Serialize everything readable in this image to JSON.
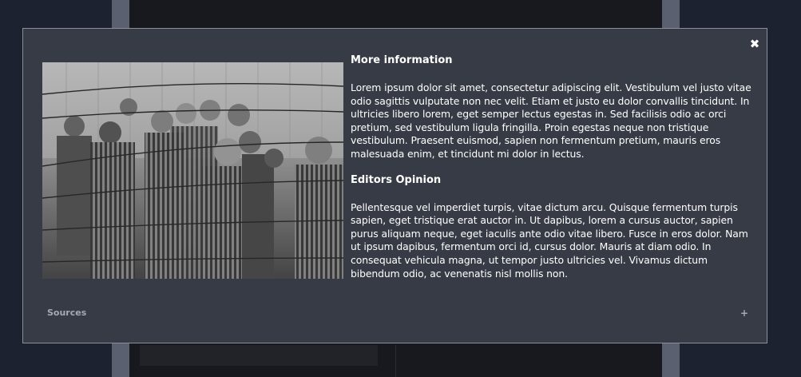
{
  "modal": {
    "close_icon": "close-icon",
    "photo_icon": "image",
    "sections": [
      {
        "heading": "More information",
        "body": "Lorem ipsum dolor sit amet, consectetur adipiscing elit. Vestibulum vel justo vitae odio sagittis vulputate non nec velit. Etiam et justo eu dolor convallis tincidunt. In ultricies libero lorem, eget semper lectus egestas in. Sed facilisis odio ac orci pretium, sed vestibulum ligula fringilla. Proin egestas neque non tristique vestibulum. Praesent euismod, sapien non fermentum pretium, mauris eros malesuada enim, et tincidunt mi dolor in lectus."
      },
      {
        "heading": "Editors Opinion",
        "body": "Pellentesque vel imperdiet turpis, vitae dictum arcu. Quisque fermentum turpis sapien, eget tristique erat auctor in. Ut dapibus, lorem a cursus auctor, sapien purus aliquam neque, eget iaculis ante odio vitae libero. Fusce in eros dolor. Nam ut ipsum dapibus, fermentum orci id, cursus dolor. Mauris at diam odio. In consequat vehicula magna, ut tempor justo ultricies vel. Vivamus dictum bibendum odio, ac venenatis nisl mollis non."
      }
    ],
    "sources": {
      "label": "Sources",
      "toggle": "+"
    }
  },
  "colors": {
    "modal_bg": "#363b45",
    "modal_border": "#8a8f99",
    "text": "#ffffff",
    "muted_text": "#a5a9b2"
  }
}
